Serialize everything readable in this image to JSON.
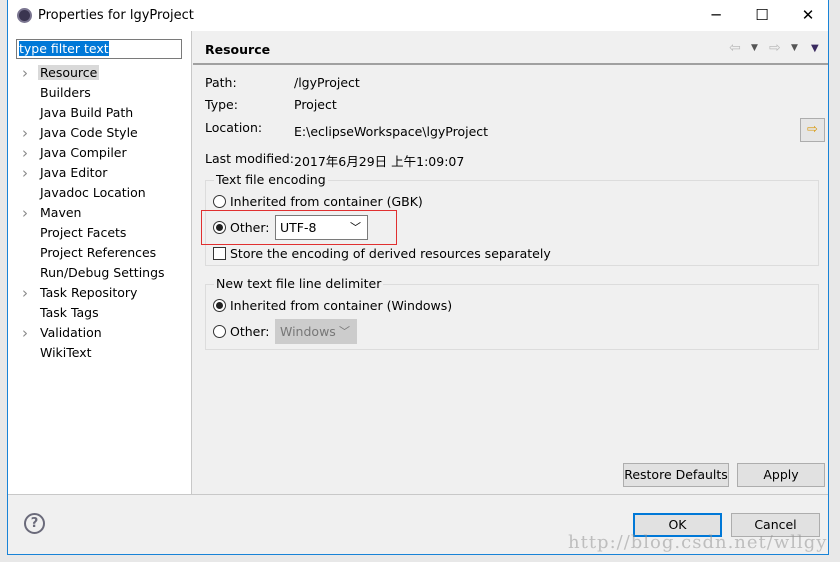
{
  "window": {
    "title": "Properties for lgyProject",
    "minimize": "─",
    "maximize": "☐",
    "close": "✕"
  },
  "filter": {
    "value": "type filter text"
  },
  "tree": [
    {
      "label": "Resource",
      "expandable": true,
      "selected": true
    },
    {
      "label": "Builders",
      "expandable": false
    },
    {
      "label": "Java Build Path",
      "expandable": false
    },
    {
      "label": "Java Code Style",
      "expandable": true
    },
    {
      "label": "Java Compiler",
      "expandable": true
    },
    {
      "label": "Java Editor",
      "expandable": true
    },
    {
      "label": "Javadoc Location",
      "expandable": false
    },
    {
      "label": "Maven",
      "expandable": true
    },
    {
      "label": "Project Facets",
      "expandable": false
    },
    {
      "label": "Project References",
      "expandable": false
    },
    {
      "label": "Run/Debug Settings",
      "expandable": false
    },
    {
      "label": "Task Repository",
      "expandable": true
    },
    {
      "label": "Task Tags",
      "expandable": false
    },
    {
      "label": "Validation",
      "expandable": true
    },
    {
      "label": "WikiText",
      "expandable": false
    }
  ],
  "page": {
    "title": "Resource",
    "path_label": "Path:",
    "path": "/lgyProject",
    "type_label": "Type:",
    "type": "Project",
    "location_label": "Location:",
    "location": "E:\\eclipseWorkspace\\lgyProject",
    "modified_label": "Last modified:",
    "modified": "2017年6月29日 上午1:09:07",
    "encoding": {
      "title": "Text file encoding",
      "inherited": "Inherited from container (GBK)",
      "other": "Other:",
      "other_value": "UTF-8",
      "selected": "other",
      "store_derived": "Store the encoding of derived resources separately",
      "store_checked": false
    },
    "delimiter": {
      "title": "New text file line delimiter",
      "inherited": "Inherited from container (Windows)",
      "other": "Other:",
      "other_value": "Windows",
      "selected": "inherited"
    },
    "restore_defaults": "Restore Defaults",
    "apply": "Apply"
  },
  "footer": {
    "help": "?",
    "ok": "OK",
    "cancel": "Cancel"
  },
  "watermark": "http://blog.csdn.net/wllgy",
  "colors": {
    "accent": "#0078d7",
    "highlight_box": "#e03030"
  }
}
